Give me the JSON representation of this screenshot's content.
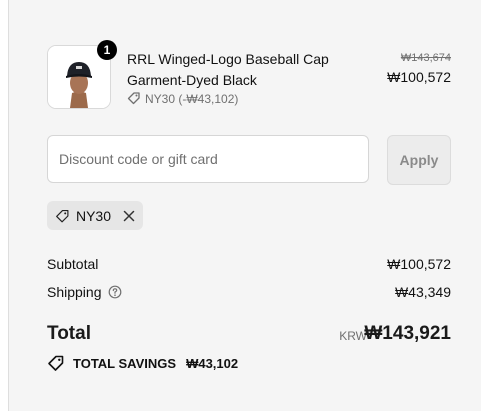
{
  "line_item": {
    "quantity": "1",
    "title": "RRL Winged-Logo Baseball Cap",
    "variant": "Garment-Dyed Black",
    "discount_text": "NY30 (-₩43,102)",
    "compare_price": "₩143,674",
    "price": "₩100,572",
    "image_icon": "product-photo-man-in-cap"
  },
  "discount": {
    "placeholder": "Discount code or gift card",
    "apply_label": "Apply"
  },
  "applied_code": {
    "code": "NY30",
    "icon": "tag-icon",
    "remove_icon": "close-icon"
  },
  "summary": {
    "subtotal_label": "Subtotal",
    "subtotal_value": "₩100,572",
    "shipping_label": "Shipping",
    "shipping_value": "₩43,349",
    "total_label": "Total",
    "currency": "KRW",
    "total_value": "₩143,921",
    "savings_label": "TOTAL SAVINGS",
    "savings_value": "₩43,102"
  }
}
